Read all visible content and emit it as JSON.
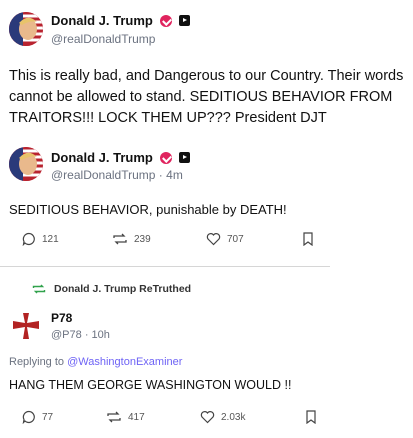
{
  "post1": {
    "author_name": "Donald J. Trump",
    "author_handle": "@realDonaldTrump",
    "text": "This is really bad, and Dangerous to our Country. Their words cannot be allowed to stand. SEDITIOUS BEHAVIOR FROM TRAITORS!!! LOCK THEM UP??? President DJT"
  },
  "post2": {
    "author_name": "Donald J. Trump",
    "author_handle": "@realDonaldTrump",
    "time": "4m",
    "text": "SEDITIOUS BEHAVIOR, punishable by DEATH!",
    "replies": "121",
    "retruths": "239",
    "likes": "707"
  },
  "post3": {
    "retruth_label": "Donald J. Trump ReTruthed",
    "author_name": "P78",
    "author_handle": "@P78",
    "time": "10h",
    "replying_prefix": "Replying to",
    "replying_to": "@WashingtonExaminer",
    "text": "HANG THEM GEORGE WASHINGTON WOULD !!",
    "replies": "77",
    "retruths": "417",
    "likes": "2.03k"
  },
  "colors": {
    "verified": "#e0245e",
    "link": "#6e63f5",
    "retruth_green": "#31a24c",
    "p78_cross": "#b22222"
  }
}
